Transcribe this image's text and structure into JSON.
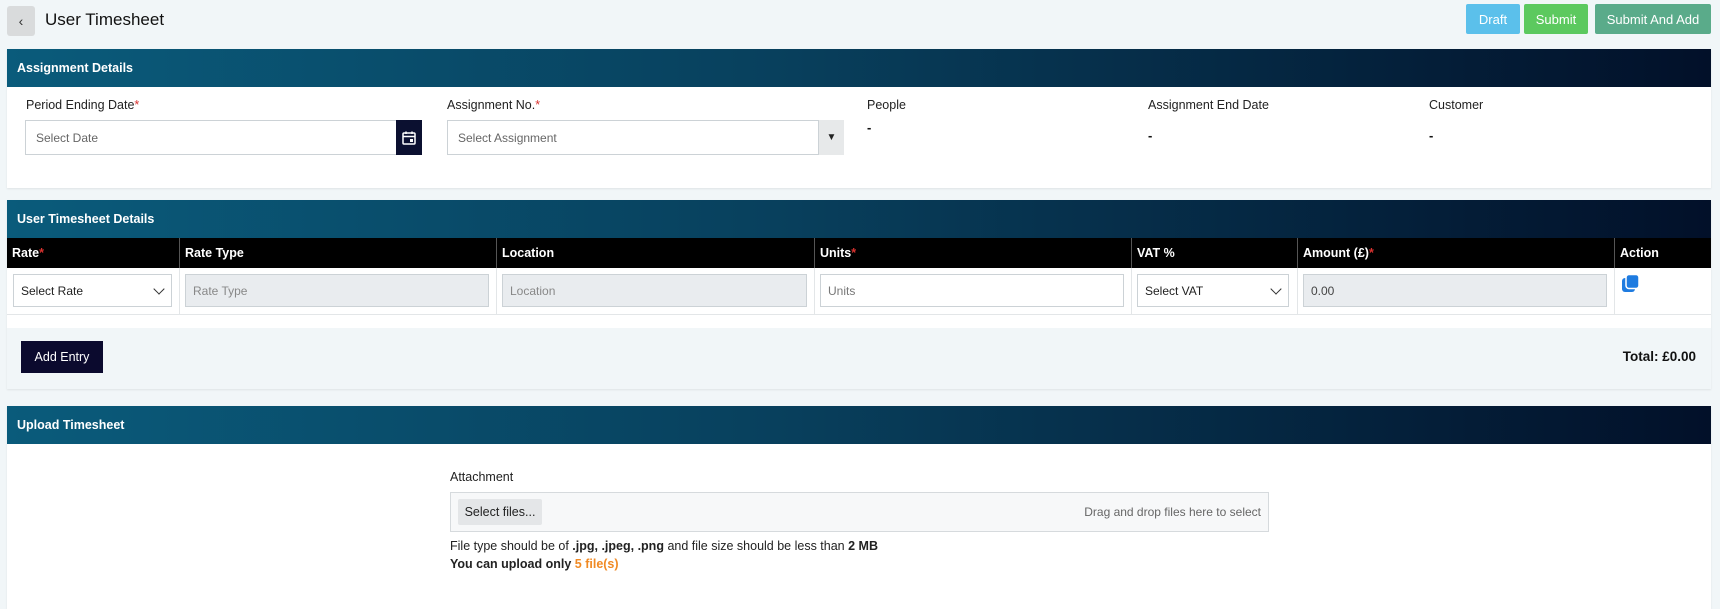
{
  "header": {
    "back_glyph": "‹",
    "title": "User Timesheet",
    "buttons": {
      "draft": "Draft",
      "submit": "Submit",
      "submit_and_add": "Submit And Add"
    }
  },
  "assignment": {
    "section_title": "Assignment Details",
    "period_ending": {
      "label": "Period Ending Date",
      "placeholder": "Select Date"
    },
    "assignment_no": {
      "label": "Assignment No.",
      "placeholder": "Select Assignment"
    },
    "people": {
      "label": "People",
      "value": "-"
    },
    "end_date": {
      "label": "Assignment End Date",
      "value": "-"
    },
    "customer": {
      "label": "Customer",
      "value": "-"
    },
    "required_mark": "*"
  },
  "timesheet": {
    "section_title": "User Timesheet Details",
    "columns": {
      "rate": "Rate",
      "rate_type": "Rate Type",
      "location": "Location",
      "units": "Units",
      "vat": "VAT %",
      "amount": "Amount (£)",
      "action": "Action"
    },
    "row": {
      "rate_select": "Select Rate",
      "rate_type_placeholder": "Rate Type",
      "location_placeholder": "Location",
      "units_placeholder": "Units",
      "vat_select": "Select VAT",
      "amount": "0.00"
    },
    "add_entry": "Add Entry",
    "total": "Total: £0.00"
  },
  "upload": {
    "section_title": "Upload Timesheet",
    "attachment_label": "Attachment",
    "select_files": "Select files...",
    "drop_hint": "Drag and drop files here to select",
    "file_hint": {
      "prefix": "File type should be of ",
      "types": ".jpg, .jpeg, .png",
      "middle": " and file size should be less than ",
      "size": "2 MB"
    },
    "limit": {
      "prefix": "You can upload only ",
      "count": "5 file(s)"
    }
  },
  "colors": {
    "header_gradient_start": "#0a5b7b",
    "header_gradient_end": "#021029",
    "draft": "#5bc0eb",
    "submit": "#5cc95f",
    "submit_and_add": "#5aab8a",
    "primary_dark": "#0b0a2e",
    "copy_icon": "#1e7be0"
  }
}
